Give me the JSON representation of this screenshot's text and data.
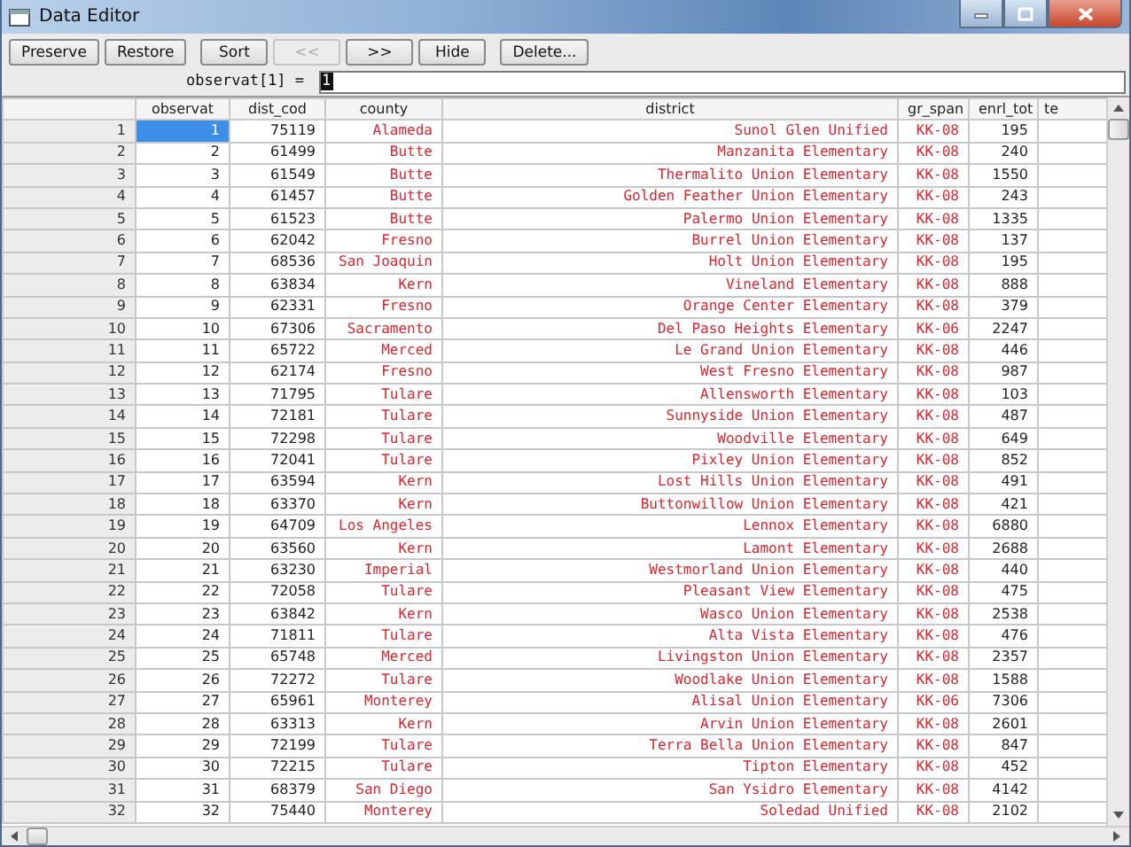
{
  "window": {
    "title": "Data Editor"
  },
  "toolbar": [
    {
      "label": "Preserve",
      "disabled": false
    },
    {
      "label": "Restore",
      "disabled": false
    },
    {
      "label": "Sort",
      "disabled": false
    },
    {
      "label": "<<",
      "disabled": true
    },
    {
      "label": ">>",
      "disabled": false
    },
    {
      "label": "Hide",
      "disabled": false
    },
    {
      "label": "Delete...",
      "disabled": false
    }
  ],
  "cell_editor": {
    "label": "observat[1] =",
    "value": "1"
  },
  "table": {
    "columns": [
      {
        "label": "observat",
        "kind": "numeric"
      },
      {
        "label": "dist_cod",
        "kind": "numeric"
      },
      {
        "label": "county",
        "kind": "string"
      },
      {
        "label": "district",
        "kind": "string"
      },
      {
        "label": "gr_span",
        "kind": "string"
      },
      {
        "label": "enrl_tot",
        "kind": "numeric"
      },
      {
        "label": "te",
        "kind": "numeric"
      }
    ],
    "rows": [
      {
        "label": "1",
        "selected": true,
        "cells": [
          "1",
          "75119",
          "Alameda",
          "Sunol Glen Unified",
          "KK-08",
          "195"
        ]
      },
      {
        "label": "2",
        "selected": false,
        "cells": [
          "2",
          "61499",
          "Butte",
          "Manzanita Elementary",
          "KK-08",
          "240"
        ]
      },
      {
        "label": "3",
        "selected": false,
        "cells": [
          "3",
          "61549",
          "Butte",
          "Thermalito Union Elementary",
          "KK-08",
          "1550"
        ]
      },
      {
        "label": "4",
        "selected": false,
        "cells": [
          "4",
          "61457",
          "Butte",
          "Golden Feather Union Elementary",
          "KK-08",
          "243"
        ]
      },
      {
        "label": "5",
        "selected": false,
        "cells": [
          "5",
          "61523",
          "Butte",
          "Palermo Union Elementary",
          "KK-08",
          "1335"
        ]
      },
      {
        "label": "6",
        "selected": false,
        "cells": [
          "6",
          "62042",
          "Fresno",
          "Burrel Union Elementary",
          "KK-08",
          "137"
        ]
      },
      {
        "label": "7",
        "selected": false,
        "cells": [
          "7",
          "68536",
          "San Joaquin",
          "Holt Union Elementary",
          "KK-08",
          "195"
        ]
      },
      {
        "label": "8",
        "selected": false,
        "cells": [
          "8",
          "63834",
          "Kern",
          "Vineland Elementary",
          "KK-08",
          "888"
        ]
      },
      {
        "label": "9",
        "selected": false,
        "cells": [
          "9",
          "62331",
          "Fresno",
          "Orange Center Elementary",
          "KK-08",
          "379"
        ]
      },
      {
        "label": "10",
        "selected": false,
        "cells": [
          "10",
          "67306",
          "Sacramento",
          "Del Paso Heights Elementary",
          "KK-06",
          "2247"
        ]
      },
      {
        "label": "11",
        "selected": false,
        "cells": [
          "11",
          "65722",
          "Merced",
          "Le Grand Union Elementary",
          "KK-08",
          "446"
        ]
      },
      {
        "label": "12",
        "selected": false,
        "cells": [
          "12",
          "62174",
          "Fresno",
          "West Fresno Elementary",
          "KK-08",
          "987"
        ]
      },
      {
        "label": "13",
        "selected": false,
        "cells": [
          "13",
          "71795",
          "Tulare",
          "Allensworth Elementary",
          "KK-08",
          "103"
        ]
      },
      {
        "label": "14",
        "selected": false,
        "cells": [
          "14",
          "72181",
          "Tulare",
          "Sunnyside Union Elementary",
          "KK-08",
          "487"
        ]
      },
      {
        "label": "15",
        "selected": false,
        "cells": [
          "15",
          "72298",
          "Tulare",
          "Woodville Elementary",
          "KK-08",
          "649"
        ]
      },
      {
        "label": "16",
        "selected": false,
        "cells": [
          "16",
          "72041",
          "Tulare",
          "Pixley Union Elementary",
          "KK-08",
          "852"
        ]
      },
      {
        "label": "17",
        "selected": false,
        "cells": [
          "17",
          "63594",
          "Kern",
          "Lost Hills Union Elementary",
          "KK-08",
          "491"
        ]
      },
      {
        "label": "18",
        "selected": false,
        "cells": [
          "18",
          "63370",
          "Kern",
          "Buttonwillow Union Elementary",
          "KK-08",
          "421"
        ]
      },
      {
        "label": "19",
        "selected": false,
        "cells": [
          "19",
          "64709",
          "Los Angeles",
          "Lennox Elementary",
          "KK-08",
          "6880"
        ]
      },
      {
        "label": "20",
        "selected": false,
        "cells": [
          "20",
          "63560",
          "Kern",
          "Lamont Elementary",
          "KK-08",
          "2688"
        ]
      },
      {
        "label": "21",
        "selected": false,
        "cells": [
          "21",
          "63230",
          "Imperial",
          "Westmorland Union Elementary",
          "KK-08",
          "440"
        ]
      },
      {
        "label": "22",
        "selected": false,
        "cells": [
          "22",
          "72058",
          "Tulare",
          "Pleasant View Elementary",
          "KK-08",
          "475"
        ]
      },
      {
        "label": "23",
        "selected": false,
        "cells": [
          "23",
          "63842",
          "Kern",
          "Wasco Union Elementary",
          "KK-08",
          "2538"
        ]
      },
      {
        "label": "24",
        "selected": false,
        "cells": [
          "24",
          "71811",
          "Tulare",
          "Alta Vista Elementary",
          "KK-08",
          "476"
        ]
      },
      {
        "label": "25",
        "selected": false,
        "cells": [
          "25",
          "65748",
          "Merced",
          "Livingston Union Elementary",
          "KK-08",
          "2357"
        ]
      },
      {
        "label": "26",
        "selected": false,
        "cells": [
          "26",
          "72272",
          "Tulare",
          "Woodlake Union Elementary",
          "KK-08",
          "1588"
        ]
      },
      {
        "label": "27",
        "selected": false,
        "cells": [
          "27",
          "65961",
          "Monterey",
          "Alisal Union Elementary",
          "KK-06",
          "7306"
        ]
      },
      {
        "label": "28",
        "selected": false,
        "cells": [
          "28",
          "63313",
          "Kern",
          "Arvin Union Elementary",
          "KK-08",
          "2601"
        ]
      },
      {
        "label": "29",
        "selected": false,
        "cells": [
          "29",
          "72199",
          "Tulare",
          "Terra Bella Union Elementary",
          "KK-08",
          "847"
        ]
      },
      {
        "label": "30",
        "selected": false,
        "cells": [
          "30",
          "72215",
          "Tulare",
          "Tipton Elementary",
          "KK-08",
          "452"
        ]
      },
      {
        "label": "31",
        "selected": false,
        "cells": [
          "31",
          "68379",
          "San Diego",
          "San Ysidro Elementary",
          "KK-08",
          "4142"
        ]
      },
      {
        "label": "32",
        "selected": false,
        "cells": [
          "32",
          "75440",
          "Monterey",
          "Soledad Unified",
          "KK-08",
          "2102"
        ]
      }
    ]
  }
}
